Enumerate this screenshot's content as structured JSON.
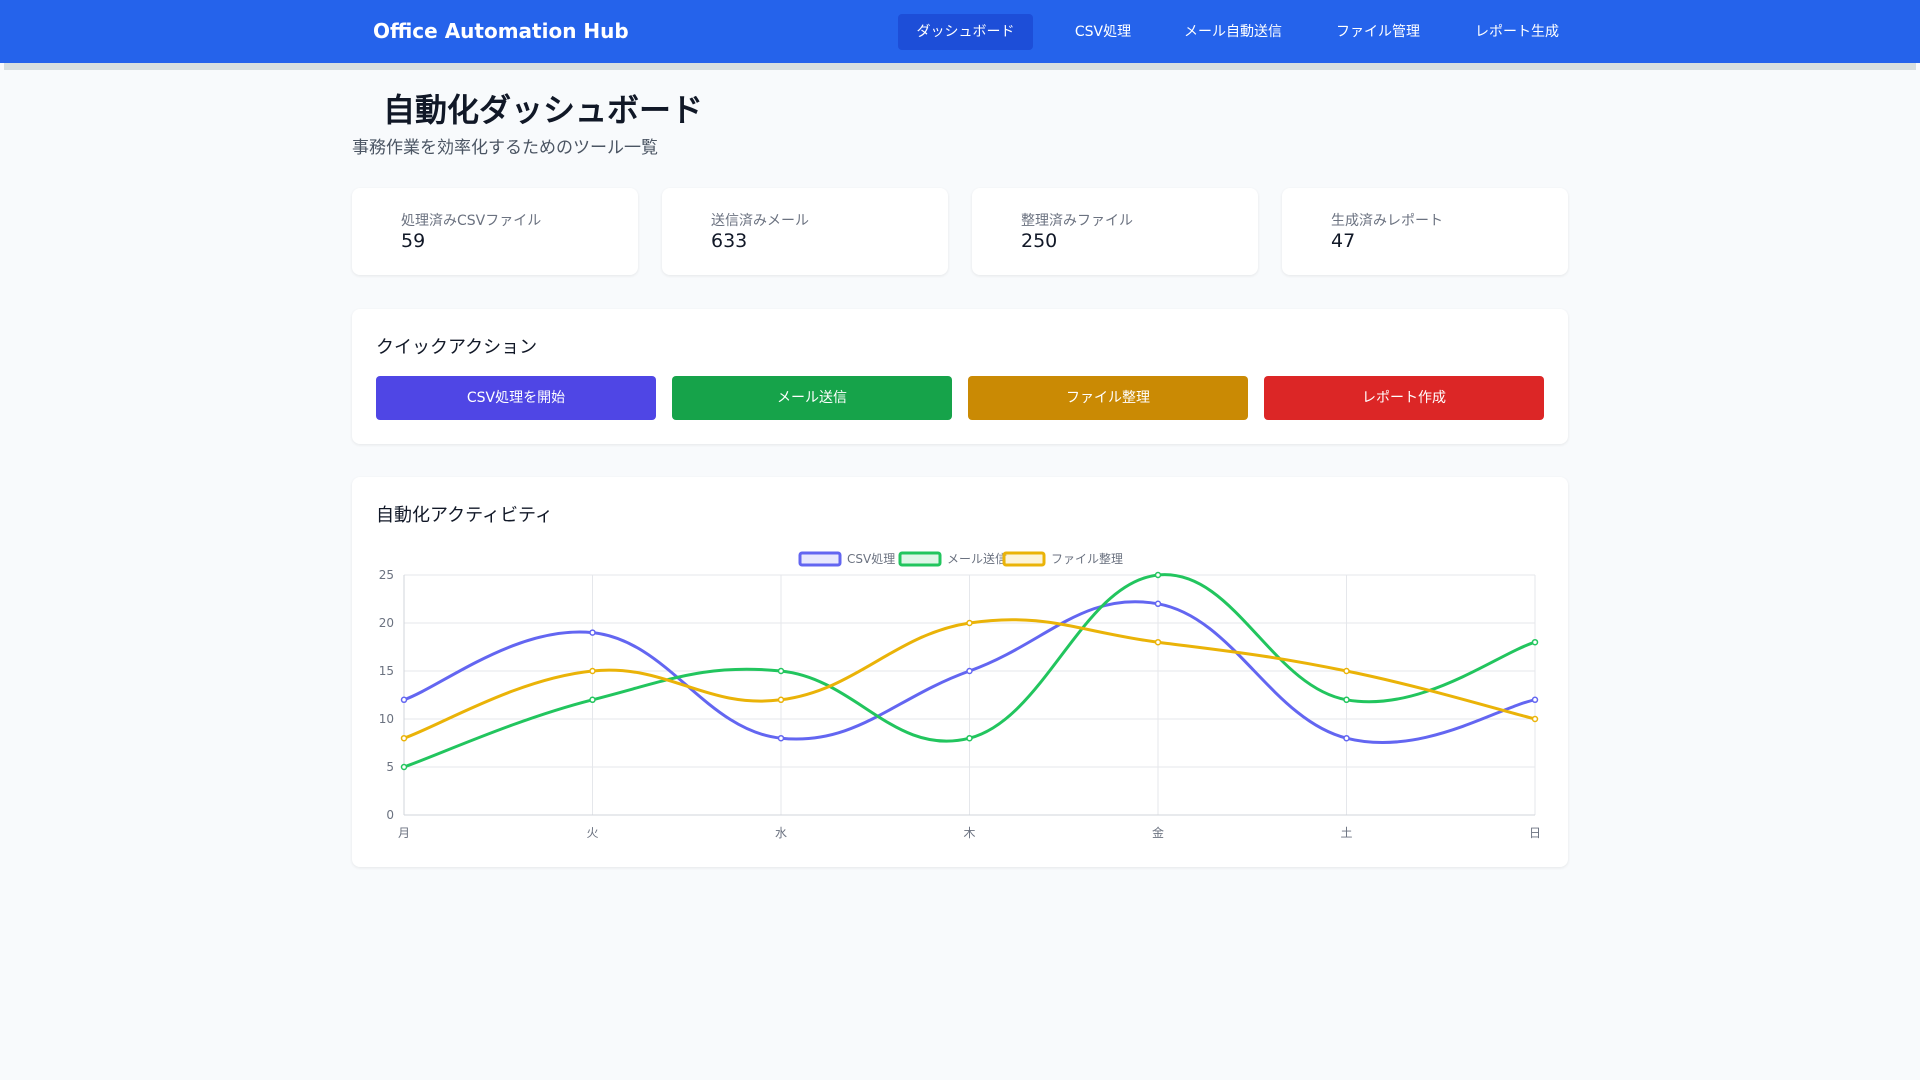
{
  "header": {
    "brand": "Office Automation Hub",
    "nav": [
      {
        "label": "ダッシュボード",
        "active": true
      },
      {
        "label": "CSV処理",
        "active": false
      },
      {
        "label": "メール自動送信",
        "active": false
      },
      {
        "label": "ファイル管理",
        "active": false
      },
      {
        "label": "レポート生成",
        "active": false
      }
    ]
  },
  "page": {
    "title": "自動化ダッシュボード",
    "subtitle": "事務作業を効率化するためのツール一覧"
  },
  "stats": [
    {
      "label": "処理済みCSVファイル",
      "value": "59"
    },
    {
      "label": "送信済みメール",
      "value": "633"
    },
    {
      "label": "整理済みファイル",
      "value": "250"
    },
    {
      "label": "生成済みレポート",
      "value": "47"
    }
  ],
  "quick_actions": {
    "title": "クイックアクション",
    "buttons": [
      {
        "label": "CSV処理を開始",
        "color": "#4f46e5"
      },
      {
        "label": "メール送信",
        "color": "#16a34a"
      },
      {
        "label": "ファイル整理",
        "color": "#ca8a04"
      },
      {
        "label": "レポート作成",
        "color": "#dc2626"
      }
    ]
  },
  "activity": {
    "title": "自動化アクティビティ"
  },
  "chart_data": {
    "type": "line",
    "categories": [
      "月",
      "火",
      "水",
      "木",
      "金",
      "土",
      "日"
    ],
    "series": [
      {
        "name": "CSV処理",
        "values": [
          12,
          19,
          8,
          15,
          22,
          8,
          12
        ],
        "color": "#6366f1"
      },
      {
        "name": "メール送信",
        "values": [
          5,
          12,
          15,
          8,
          25,
          12,
          18
        ],
        "color": "#22c55e"
      },
      {
        "name": "ファイル整理",
        "values": [
          8,
          15,
          12,
          20,
          18,
          15,
          10
        ],
        "color": "#eab308"
      }
    ],
    "ylim": [
      0,
      25
    ],
    "yticks": [
      0,
      5,
      10,
      15,
      20,
      25
    ],
    "grid": true,
    "legend": "top-center",
    "smooth": true
  }
}
